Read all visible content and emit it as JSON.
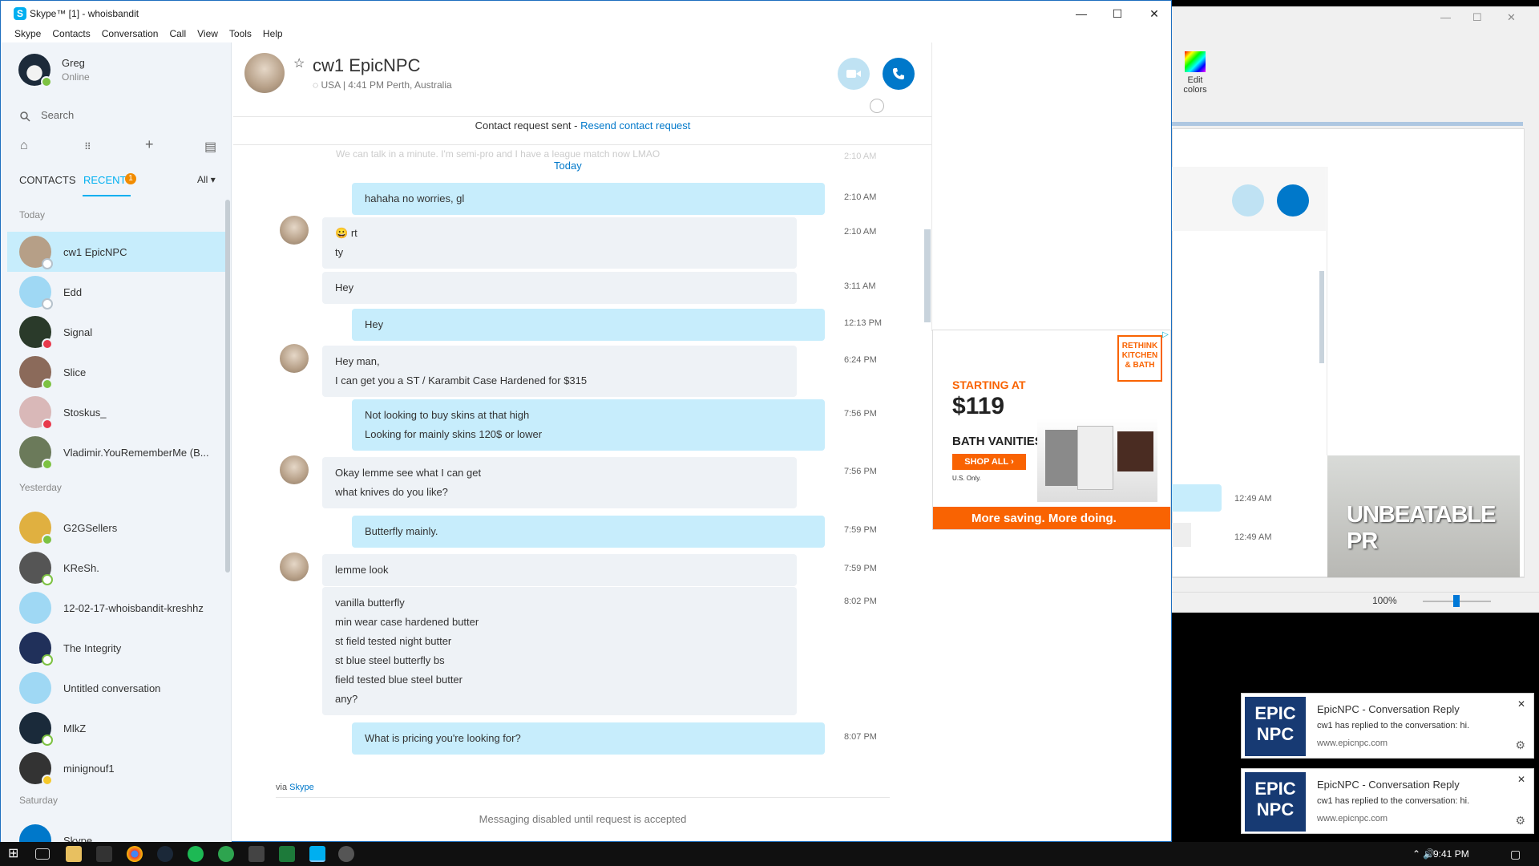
{
  "window": {
    "title": "Skype™ [1] - whoisbandit",
    "minimize": "—",
    "maximize": "☐",
    "close": "✕"
  },
  "menu": [
    "Skype",
    "Contacts",
    "Conversation",
    "Call",
    "View",
    "Tools",
    "Help"
  ],
  "me": {
    "name": "Greg",
    "status": "Online"
  },
  "search": {
    "placeholder": "Search"
  },
  "tabs": {
    "contacts": "CONTACTS",
    "recent": "RECENT",
    "recent_count": "1",
    "filter": "All"
  },
  "groups": {
    "today": "Today",
    "yesterday": "Yesterday",
    "saturday": "Saturday"
  },
  "contacts": [
    {
      "name": "cw1 EpicNPC",
      "status": "unknown",
      "color": "#b69f87"
    },
    {
      "name": "Edd",
      "status": "unknown",
      "color": "#9fd8f4"
    },
    {
      "name": "Signal",
      "status": "busy",
      "color": "#2a3a2a"
    },
    {
      "name": "Slice",
      "status": "online",
      "color": "#8b6a5a"
    },
    {
      "name": "Stoskus_",
      "status": "busy",
      "color": "#d9b8b8"
    },
    {
      "name": "Vladimir.YouRememberMe (B...",
      "status": "online",
      "color": "#6b7a5a"
    },
    {
      "name": "G2GSellers",
      "status": "online",
      "color": "#e0b040"
    },
    {
      "name": "KReSh.",
      "status": "offline",
      "color": "#555555"
    },
    {
      "name": "12-02-17-whoisbandit-kreshhz",
      "status": "none",
      "color": "#9fd8f4"
    },
    {
      "name": "The Integrity",
      "status": "offline",
      "color": "#20305a"
    },
    {
      "name": "Untitled conversation",
      "status": "none",
      "color": "#9fd8f4"
    },
    {
      "name": "MlkZ",
      "status": "offline",
      "color": "#1a2a3a"
    },
    {
      "name": "minignouf1",
      "status": "away",
      "color": "#333333"
    },
    {
      "name": "Skype",
      "status": "none",
      "color": "#0078ca"
    }
  ],
  "conversation": {
    "name": "cw1 EpicNPC",
    "sub": "USA  |  4:41 PM Perth, Australia",
    "request_text": "Contact request sent - ",
    "request_link": "Resend contact request",
    "ghost": "We can talk in a minute. I'm semi-pro and I have a league match now LMAO",
    "ghost_time": "2:10 AM",
    "today": "Today",
    "via": "via ",
    "via_link": "Skype",
    "disabled": "Messaging disabled until request is accepted"
  },
  "messages": [
    {
      "dir": "out",
      "lines": [
        "hahaha no worries, gl"
      ],
      "time": "2:10 AM"
    },
    {
      "dir": "in",
      "lines": [
        "rt",
        "ty"
      ],
      "time": "2:10 AM",
      "emoji": "😀"
    },
    {
      "dir": "in",
      "lines": [
        "Hey"
      ],
      "time": "3:11 AM"
    },
    {
      "dir": "out",
      "lines": [
        "Hey"
      ],
      "time": "12:13 PM"
    },
    {
      "dir": "in",
      "lines": [
        "Hey man,",
        "I can get you a ST / Karambit Case Hardened for $315"
      ],
      "time": "6:24 PM"
    },
    {
      "dir": "out",
      "lines": [
        "Not looking to buy skins at that high",
        "Looking for mainly skins 120$ or lower"
      ],
      "time": "7:56 PM"
    },
    {
      "dir": "in",
      "lines": [
        "Okay lemme see what I can get",
        "what knives do you like?"
      ],
      "time": "7:56 PM"
    },
    {
      "dir": "out",
      "lines": [
        "Butterfly mainly."
      ],
      "time": "7:59 PM"
    },
    {
      "dir": "in",
      "lines": [
        "lemme look"
      ],
      "time": "7:59 PM"
    },
    {
      "dir": "in",
      "lines": [
        "vanilla butterfly",
        "min wear case hardened butter",
        "st field tested night butter",
        "st blue steel butterfly bs",
        "field tested blue steel butter",
        "any?"
      ],
      "time": "8:02 PM"
    },
    {
      "dir": "out",
      "lines": [
        "What is pricing you're looking for?"
      ],
      "time": "8:07 PM"
    }
  ],
  "ad": {
    "start": "STARTING AT",
    "price": "$119",
    "product": "BATH VANITIES",
    "cta": "SHOP ALL ›",
    "note": "U.S. Only.",
    "badge": "RETHINK KITCHEN & BATH",
    "footer": "More saving. More doing.",
    "brand_color": "#f96302"
  },
  "background_app": {
    "edit_colors": "Edit colors",
    "times": [
      "12:49 AM",
      "12:49 AM"
    ],
    "ad_text": "UNBEATABLE PR",
    "zoom": "100%"
  },
  "notifications": [
    {
      "logo": "EPIC NPC",
      "title": "EpicNPC - Conversation Reply",
      "body": "cw1 has replied to the conversation: hi.",
      "source": "www.epicnpc.com"
    },
    {
      "logo": "EPIC NPC",
      "title": "EpicNPC - Conversation Reply",
      "body": "cw1 has replied to the conversation: hi.",
      "source": "www.epicnpc.com"
    }
  ],
  "taskbar": {
    "clock": "9:41 PM"
  },
  "colors": {
    "accent": "#00aff0",
    "call": "#0078ca",
    "bubble_out": "#c7edfc",
    "bubble_in": "#eef2f6"
  }
}
